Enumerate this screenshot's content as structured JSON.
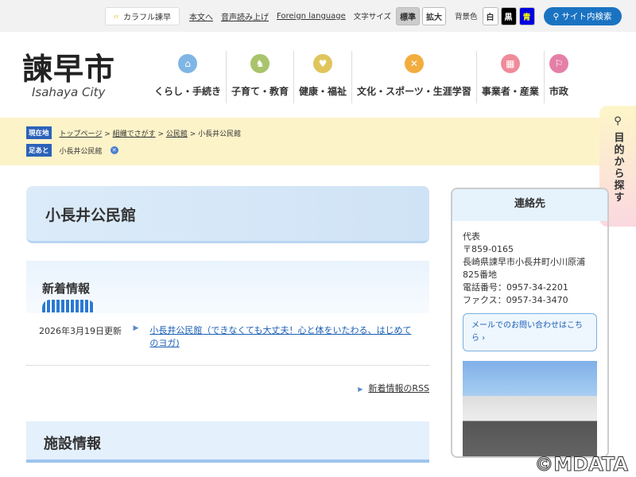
{
  "topbar": {
    "colorful": "カラフル諫早",
    "skip": "本文へ",
    "speech": "音声読み上げ",
    "foreign": "Foreign language",
    "fontsize_label": "文字サイズ",
    "font_standard": "標準",
    "font_large": "拡大",
    "bg_label": "背景色",
    "bg_white": "白",
    "bg_black": "黒",
    "bg_blue": "青",
    "search": "サイト内検索"
  },
  "logo": {
    "name": "諫早市",
    "sub": "Isahaya City"
  },
  "nav": [
    {
      "label": "くらし・手続き",
      "color": "#7fb6e6"
    },
    {
      "label": "子育て・教育",
      "color": "#a9c46b"
    },
    {
      "label": "健康・福祉",
      "color": "#e0c55c"
    },
    {
      "label": "文化・スポーツ・生涯学習",
      "color": "#f2ad3e"
    },
    {
      "label": "事業者・産業",
      "color": "#ef8b9a"
    },
    {
      "label": "市政",
      "color": "#e57fa8"
    }
  ],
  "breadcrumb": {
    "current_label": "現在地",
    "items": [
      "トップページ",
      "組織でさがす",
      "公民館"
    ],
    "current": "小長井公民館",
    "history_label": "足あと",
    "history_item": "小長井公民館"
  },
  "side_search": "目的から探す",
  "main": {
    "title": "小長井公民館",
    "news_heading": "新着情報",
    "news": [
      {
        "date": "2026年3月19日更新",
        "title": "小長井公民館（できなくても大丈夫！心と体をいたわる、はじめてのヨガ)"
      }
    ],
    "rss": "新着情報のRSS",
    "facility_heading": "施設情報"
  },
  "contact": {
    "heading": "連絡先",
    "lines": [
      "代表",
      "〒859-0165",
      "長崎県諫早市小長井町小川原浦825番地",
      "電話番号：0957-34-2201",
      "ファクス：0957-34-3470"
    ],
    "mail": "メールでのお問い合わせはこちら ›"
  },
  "watermark": "©MDATA"
}
